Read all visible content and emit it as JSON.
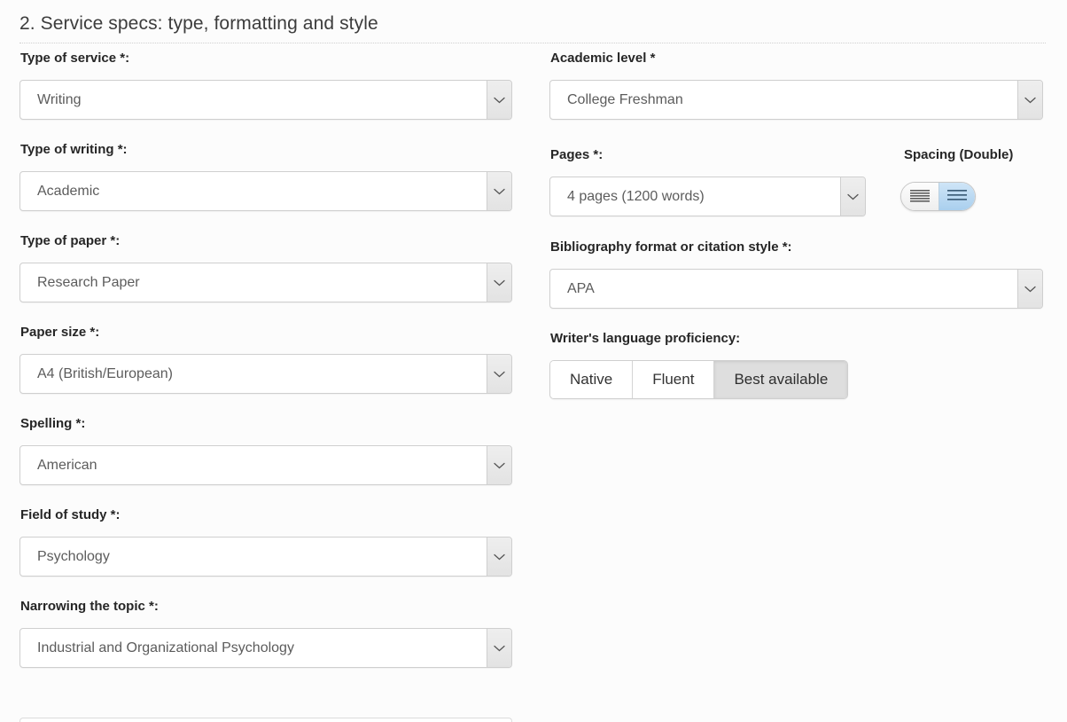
{
  "section": {
    "heading": "2. Service specs: type, formatting and style"
  },
  "left_column": {
    "fields": [
      {
        "label": "Type of service *:",
        "value": "Writing",
        "name": "type-of-service"
      },
      {
        "label": "Type of writing *:",
        "value": "Academic",
        "name": "type-of-writing"
      },
      {
        "label": "Type of paper *:",
        "value": "Research Paper",
        "name": "type-of-paper"
      },
      {
        "label": "Paper size *:",
        "value": "A4 (British/European)",
        "name": "paper-size"
      },
      {
        "label": "Spelling *:",
        "value": "American",
        "name": "spelling"
      },
      {
        "label": "Field of study *:",
        "value": "Psychology",
        "name": "field-of-study"
      },
      {
        "label": "Narrowing the topic *:",
        "value": "Industrial and Organizational Psychology",
        "name": "narrowing-the-topic"
      }
    ]
  },
  "right_column": {
    "academic_level": {
      "label": "Academic level *",
      "value": "College Freshman"
    },
    "pages": {
      "label": "Pages *:",
      "value": "4 pages (1200 words)"
    },
    "spacing": {
      "label": "Spacing (Double)",
      "options": [
        "Single",
        "Double"
      ],
      "selected": "Double",
      "selected_color": "#a9cfee"
    },
    "bibliography": {
      "label": "Bibliography format or citation style *:",
      "value": "APA"
    },
    "proficiency": {
      "label": "Writer's language proficiency:",
      "options": [
        "Native",
        "Fluent",
        "Best available"
      ],
      "selected": "Best available",
      "selected_color": "#dedede"
    }
  }
}
